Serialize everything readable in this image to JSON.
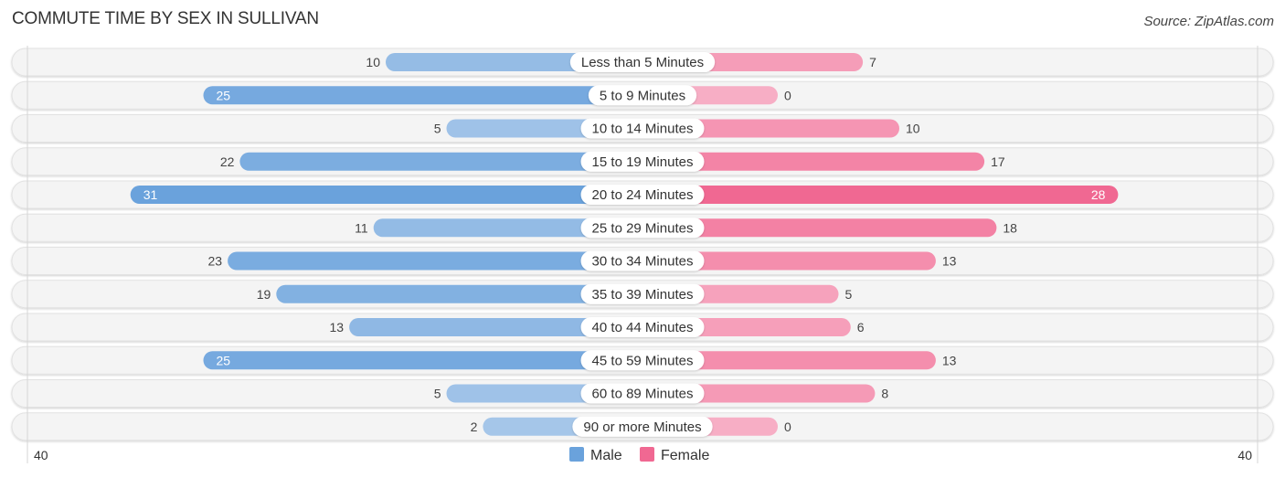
{
  "chart_data": {
    "type": "bar",
    "orientation": "horizontal-diverging",
    "title": "COMMUTE TIME BY SEX IN SULLIVAN",
    "source": "Source: ZipAtlas.com",
    "categories": [
      "Less than 5 Minutes",
      "5 to 9 Minutes",
      "10 to 14 Minutes",
      "15 to 19 Minutes",
      "20 to 24 Minutes",
      "25 to 29 Minutes",
      "30 to 34 Minutes",
      "35 to 39 Minutes",
      "40 to 44 Minutes",
      "45 to 59 Minutes",
      "60 to 89 Minutes",
      "90 or more Minutes"
    ],
    "series": [
      {
        "name": "Male",
        "color": "#6aa2dc",
        "values": [
          10,
          25,
          5,
          22,
          31,
          11,
          23,
          19,
          13,
          25,
          5,
          2
        ]
      },
      {
        "name": "Female",
        "color": "#f06892",
        "values": [
          7,
          0,
          10,
          17,
          28,
          18,
          13,
          5,
          6,
          13,
          8,
          0
        ]
      }
    ],
    "axis": {
      "left_tick": "40",
      "right_tick": "40",
      "range": [
        0,
        40
      ]
    },
    "legend": {
      "position": "bottom-center",
      "items": [
        "Male",
        "Female"
      ]
    },
    "xlabel": "",
    "ylabel": ""
  }
}
